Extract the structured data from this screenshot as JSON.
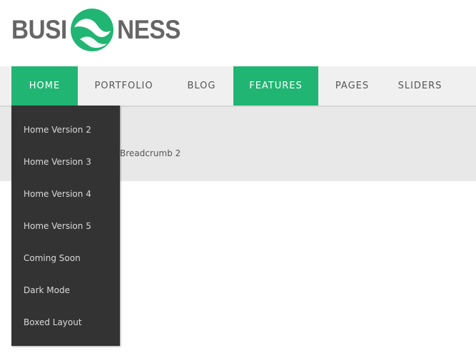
{
  "brand": {
    "left_text": "BUSI",
    "right_text": "NESS",
    "mark_color": "#21b573",
    "text_color": "#666666"
  },
  "nav": {
    "items": [
      {
        "label": "HOME",
        "active": true
      },
      {
        "label": "PORTFOLIO",
        "active": false
      },
      {
        "label": "BLOG",
        "active": false
      },
      {
        "label": "FEATURES",
        "active": true
      },
      {
        "label": "PAGES",
        "active": false
      },
      {
        "label": "SLIDERS",
        "active": false
      }
    ],
    "accent_color": "#21b573"
  },
  "dropdown": {
    "items": [
      {
        "label": "Home Version 2"
      },
      {
        "label": "Home Version 3"
      },
      {
        "label": "Home Version 4"
      },
      {
        "label": "Home Version 5"
      },
      {
        "label": "Coming Soon"
      },
      {
        "label": "Dark Mode"
      },
      {
        "label": "Boxed Layout"
      }
    ],
    "background_color": "#333333"
  },
  "breadcrumb": {
    "current": "Breadcrumb 2"
  }
}
